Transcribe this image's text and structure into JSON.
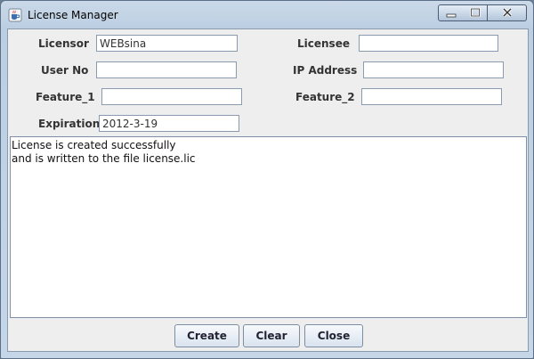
{
  "window": {
    "title": "License Manager",
    "icon": "java-cup-icon"
  },
  "form": {
    "licensor": {
      "label": "Licensor",
      "value": "WEBsina"
    },
    "licensee": {
      "label": "Licensee",
      "value": ""
    },
    "user_no": {
      "label": "User No",
      "value": ""
    },
    "ip_address": {
      "label": "IP Address",
      "value": ""
    },
    "feature_1": {
      "label": "Feature_1",
      "value": ""
    },
    "feature_2": {
      "label": "Feature_2",
      "value": ""
    },
    "expiration": {
      "label": "Expiration",
      "value": "2012-3-19"
    }
  },
  "output": {
    "lines": [
      "License is created successfully",
      "and is written to the file license.lic"
    ]
  },
  "buttons": {
    "create": "Create",
    "clear": "Clear",
    "close": "Close"
  }
}
